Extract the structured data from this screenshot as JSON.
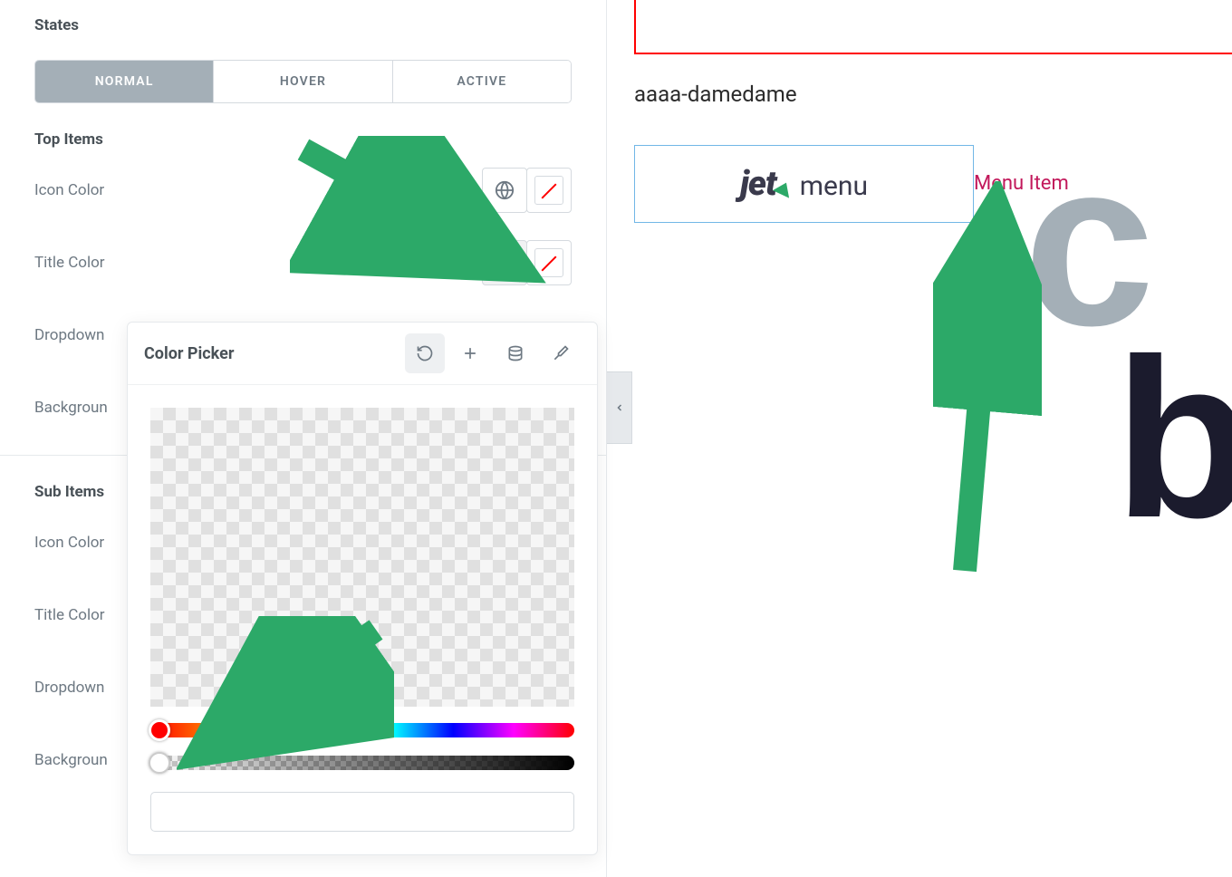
{
  "sidebar": {
    "states_label": "States",
    "tabs": {
      "normal": "NORMAL",
      "hover": "HOVER",
      "active": "ACTIVE"
    },
    "top_items_label": "Top Items",
    "sub_items_label": "Sub Items",
    "rows": {
      "icon_color": "Icon Color",
      "title_color": "Title Color",
      "dropdown": "Dropdown",
      "background": "Backgroun"
    }
  },
  "picker": {
    "title": "Color Picker",
    "hex_value": ""
  },
  "preview": {
    "heading": "aaaa-damedame",
    "logo_bold": "jet",
    "logo_rest": "menu",
    "menu_item": "Menu Item"
  },
  "colors": {
    "arrow": "#2ca968",
    "accent_red": "#ff0000",
    "menu_item_pink": "#c2185b",
    "selection_blue": "#72b7e6"
  }
}
